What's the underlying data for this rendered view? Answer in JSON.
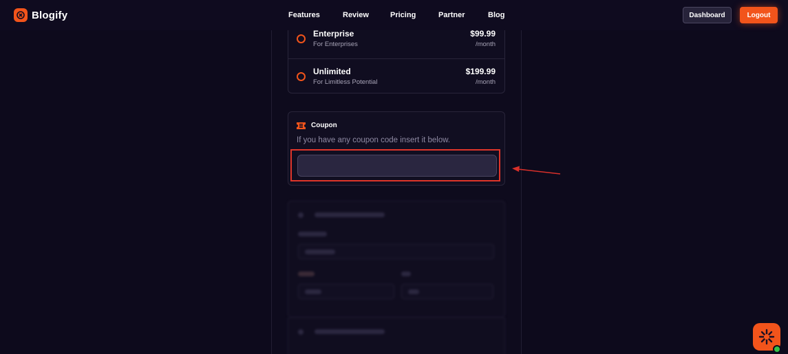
{
  "header": {
    "brand": "Blogify",
    "nav": {
      "features": "Features",
      "review": "Review",
      "pricing": "Pricing",
      "partner": "Partner",
      "blog": "Blog"
    },
    "dashboard_label": "Dashboard",
    "logout_label": "Logout"
  },
  "plans": [
    {
      "name": "Enterprise",
      "subtitle": "For Enterprises",
      "price": "$99.99",
      "period": "/month"
    },
    {
      "name": "Unlimited",
      "subtitle": "For Limitless Potential",
      "price": "$199.99",
      "period": "/month"
    }
  ],
  "coupon": {
    "title": "Coupon",
    "description": "If you have any coupon code insert it below.",
    "value": ""
  },
  "colors": {
    "accent": "#f2541b",
    "background": "#0d0a1c",
    "highlight": "#e0352a"
  },
  "icons": {
    "brand": "brand-logo-icon",
    "coupon": "ticket-icon",
    "radio": "radio-unchecked-icon",
    "chat": "chat-widget-icon"
  }
}
